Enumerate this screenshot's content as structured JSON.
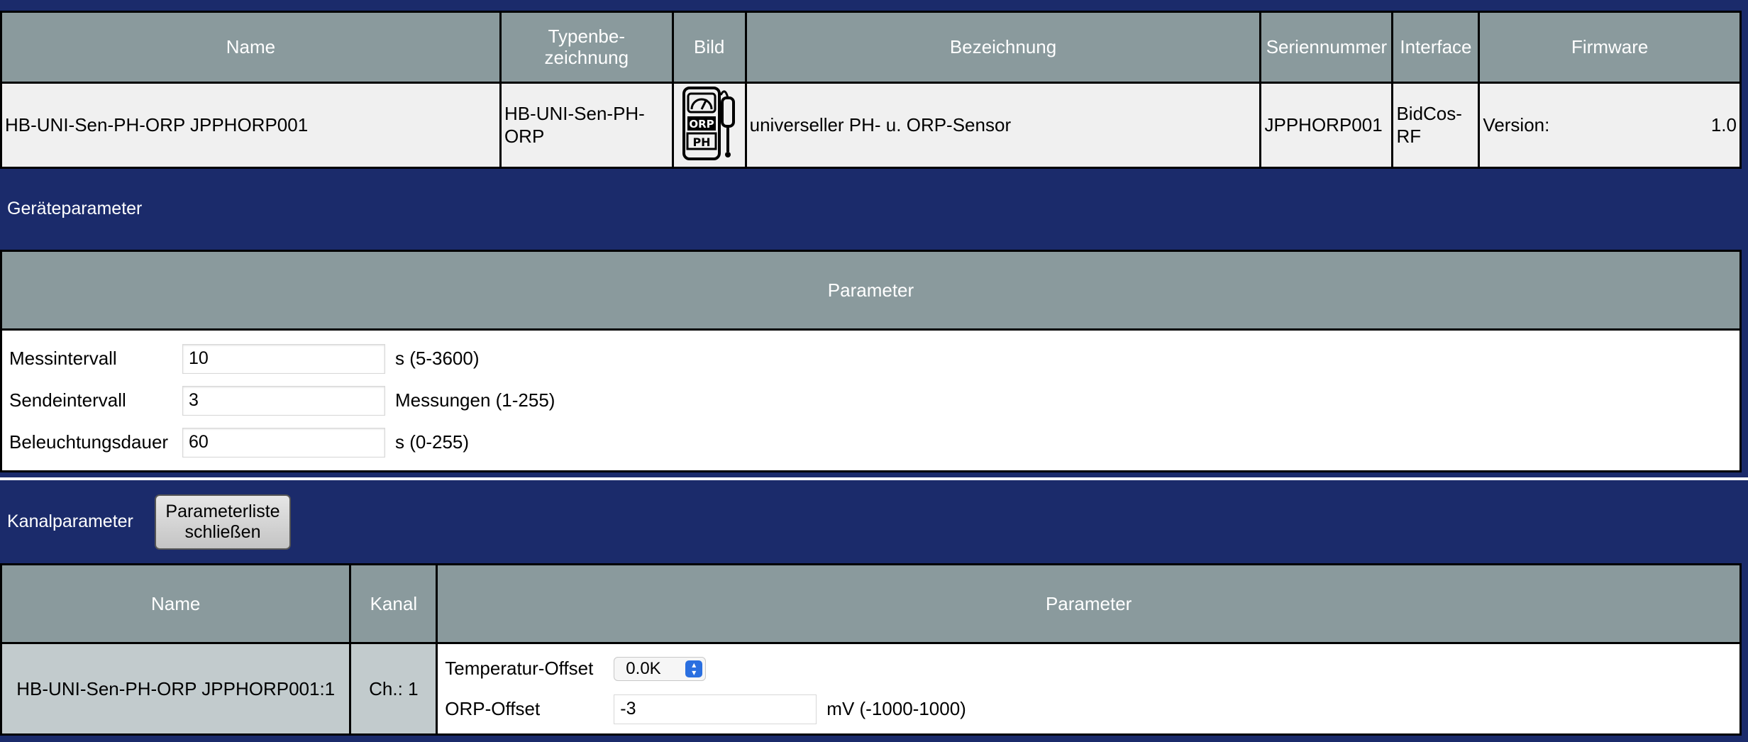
{
  "device": {
    "headers": {
      "name": "Name",
      "type": "Typenbe-\nzeichnung",
      "image": "Bild",
      "description": "Bezeichnung",
      "serial": "Seriennummer",
      "interface": "Interface",
      "firmware": "Firmware"
    },
    "row": {
      "name": "HB-UNI-Sen-PH-ORP JPPHORP001",
      "type": "HB-UNI-Sen-PH-ORP",
      "image_icon": "ph-orp-meter-icon",
      "image_text_top": "ORP",
      "image_text_bottom": "PH",
      "description": "universeller PH- u. ORP-Sensor",
      "serial": "JPPHORP001",
      "interface": "BidCos-RF",
      "firmware_label": "Version:",
      "firmware_value": "1.0"
    }
  },
  "device_params": {
    "section_title": "Geräteparameter",
    "header": "Parameter",
    "rows": [
      {
        "label": "Messintervall",
        "value": "10",
        "unit": "s (5-3600)"
      },
      {
        "label": "Sendeintervall",
        "value": "3",
        "unit": "Messungen (1-255)"
      },
      {
        "label": "Beleuchtungsdauer",
        "value": "60",
        "unit": "s (0-255)"
      }
    ]
  },
  "channel_params": {
    "section_title": "Kanalparameter",
    "close_button": "Parameterliste\nschließen",
    "headers": {
      "name": "Name",
      "channel": "Kanal",
      "params": "Parameter"
    },
    "row": {
      "name": "HB-UNI-Sen-PH-ORP JPPHORP001:1",
      "channel": "Ch.: 1",
      "temp_label": "Temperatur-Offset",
      "temp_value": "0.0K",
      "orp_label": "ORP-Offset",
      "orp_value": "-3",
      "orp_unit": "mV (-1000-1000)"
    }
  },
  "colors": {
    "background": "#1b2b6b",
    "header_gray": "#8a9a9d",
    "row_light": "#f0f0f0",
    "channel_cell": "#c2cbcd",
    "select_accent": "#2a6fe0"
  }
}
